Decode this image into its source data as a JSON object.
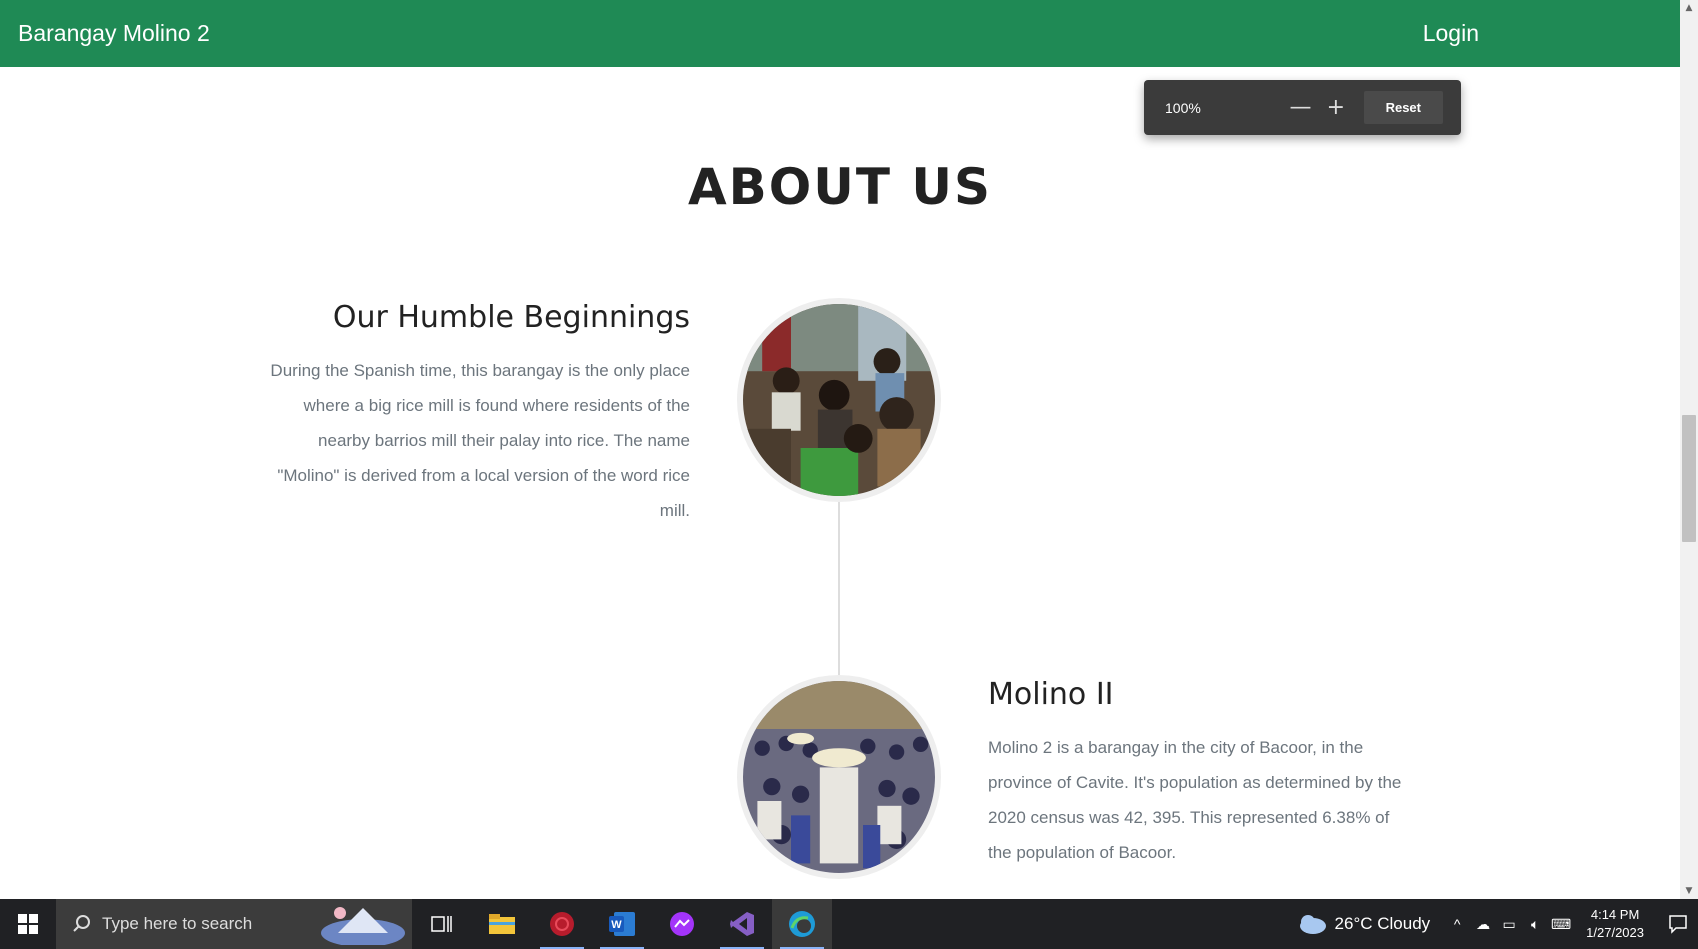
{
  "navbar": {
    "brand": "Barangay Molino 2",
    "login": "Login"
  },
  "zoom": {
    "value": "100%",
    "minus": "—",
    "plus": "+",
    "reset": "Reset"
  },
  "about": {
    "title": "ABOUT US",
    "sections": [
      {
        "heading": "Our Humble Beginnings",
        "text": "During the Spanish time, this barangay is the only place where a big rice mill is found where residents of the nearby barrios mill their palay into rice. The name \"Molino\" is derived from a local version of the word rice mill."
      },
      {
        "heading": "Molino II",
        "text": "Molino 2 is a barangay in the city of Bacoor, in the province of Cavite. It's population as determined by the 2020 census was 42, 395. This represented 6.38% of the population of Bacoor."
      }
    ]
  },
  "taskbar": {
    "search_placeholder": "Type here to search",
    "weather": "26°C  Cloudy",
    "time": "4:14 PM",
    "date": "1/27/2023"
  },
  "colors": {
    "navbar": "#1f8a55",
    "taskbar": "#202124"
  }
}
